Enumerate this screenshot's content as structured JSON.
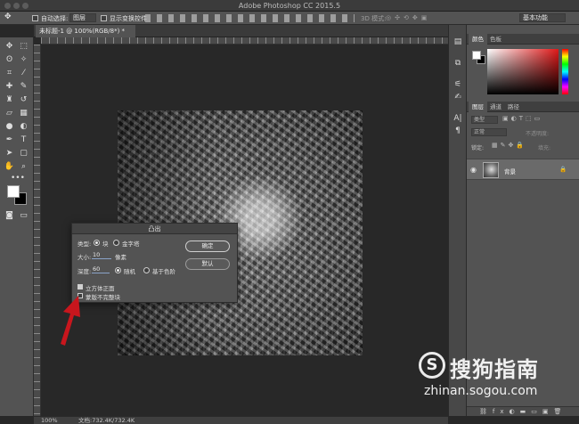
{
  "window": {
    "title": "Adobe Photoshop CC 2015.5"
  },
  "options_bar": {
    "auto_select_label": "自动选择:",
    "auto_select_value": "图层",
    "show_transform_label": "显示变换控件",
    "mode_3d_label": "3D 模式:",
    "workspace_value": "基本功能"
  },
  "document": {
    "tab_label": "未标题-1 @ 100%(RGB/8*) *"
  },
  "dialog": {
    "title": "凸出",
    "type_label": "类型:",
    "type_options": [
      "块",
      "金字塔"
    ],
    "selected_type": "块",
    "size_label": "大小:",
    "size_value": "10",
    "size_unit": "像素",
    "depth_label": "深度:",
    "depth_value": "60",
    "depth_options": [
      "随机",
      "基于色阶"
    ],
    "selected_depth_option": "随机",
    "solid_front_label": "立方体正面",
    "solid_front_checked": true,
    "mask_incomplete_label": "蒙版不完整块",
    "mask_incomplete_checked": false,
    "ok_label": "确定",
    "default_label": "默认"
  },
  "right_panel": {
    "color_tabs": [
      "颜色",
      "色板"
    ],
    "layer_tabs": [
      "图层",
      "通道",
      "路径"
    ],
    "kind_label": "类型",
    "blend_mode": "正常",
    "opacity_label": "不透明度:",
    "lock_label": "锁定:",
    "fill_label": "填充:",
    "layer_name": "背景"
  },
  "status": {
    "zoom": "100%",
    "doc_size": "文档:732.4K/732.4K"
  },
  "watermark": {
    "name": "搜狗指南",
    "url": "zhinan.sogou.com"
  },
  "colors": {
    "foreground": "#ffffff",
    "background": "#000000",
    "spectrum_hue": "#e01818",
    "arrow": "#c8161d"
  },
  "icons": {
    "tools": [
      "move-icon",
      "marquee-icon",
      "lasso-icon",
      "magic-wand-icon",
      "crop-icon",
      "eyedropper-icon",
      "healing-brush-icon",
      "brush-icon",
      "clone-stamp-icon",
      "history-brush-icon",
      "eraser-icon",
      "gradient-icon",
      "blur-icon",
      "dodge-icon",
      "pen-icon",
      "type-icon",
      "path-select-icon",
      "shape-icon",
      "hand-icon",
      "zoom-icon"
    ]
  }
}
